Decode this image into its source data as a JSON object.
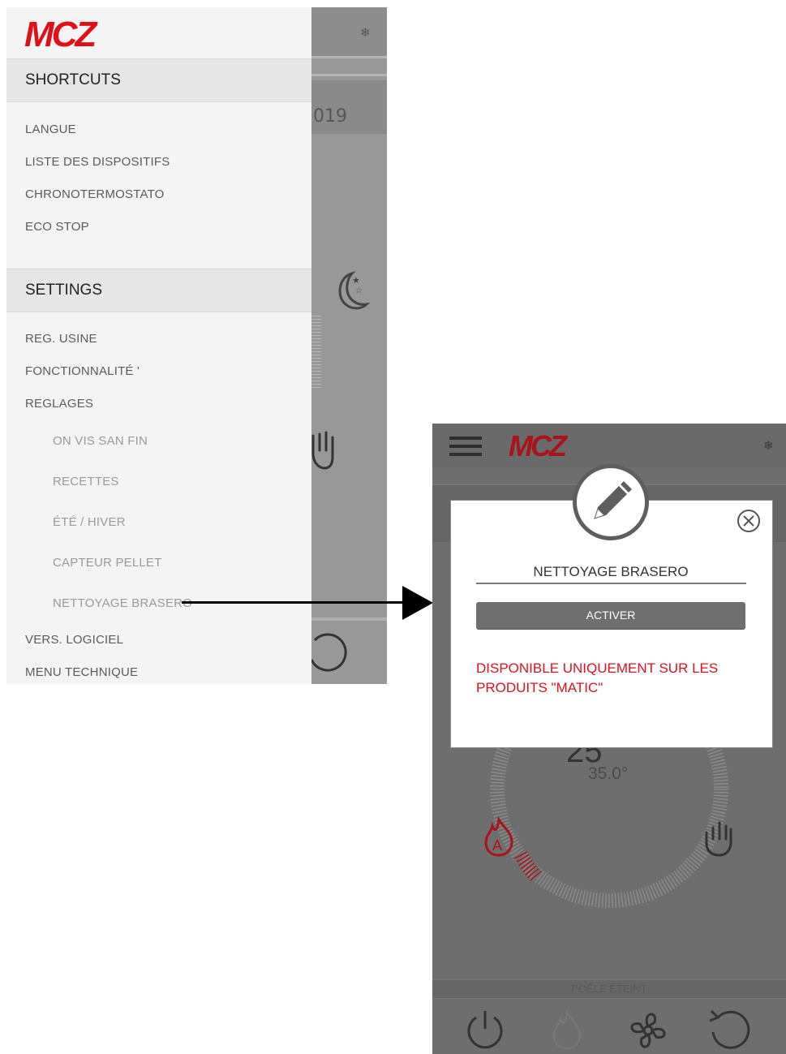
{
  "left_screen": {
    "background": {
      "year_fragment": "019",
      "gear_icon": "gear-icon",
      "moon_icon": "moon-stars-icon",
      "hand_icon": "hand-icon",
      "refresh_icon": "refresh-icon"
    },
    "drawer": {
      "logo_text": "MCZ",
      "shortcuts_header": "SHORTCUTS",
      "shortcuts": [
        "LANGUE",
        "LISTE DES DISPOSITIFS",
        "CHRONOTERMOSTATO",
        "ECO STOP"
      ],
      "settings_header": "SETTINGS",
      "settings": [
        "REG. USINE",
        "FONCTIONNALITÉ '",
        "REGLAGES"
      ],
      "reglages_sub": [
        "ON VIS SAN FIN",
        "RECETTES",
        "ÉTÉ / HIVER",
        "CAPTEUR PELLET",
        "NETTOYAGE BRASERO"
      ],
      "settings_more": [
        "VERS. LOGICIEL",
        "MENU TECHNIQUE"
      ]
    }
  },
  "right_screen": {
    "logo_text": "MCZ",
    "temperature_target": "35.0°",
    "status_text": "POÊLE ÉTEINT",
    "dialog": {
      "title": "NETTOYAGE BRASERO",
      "button_label": "ACTIVER",
      "warning": "DISPONIBLE UNIQUEMENT SUR LES PRODUITS \"MATIC\""
    }
  },
  "colors": {
    "brand_red": "#e0101a",
    "warning_red": "#e0101a",
    "button_grey": "#6f6f6f"
  }
}
